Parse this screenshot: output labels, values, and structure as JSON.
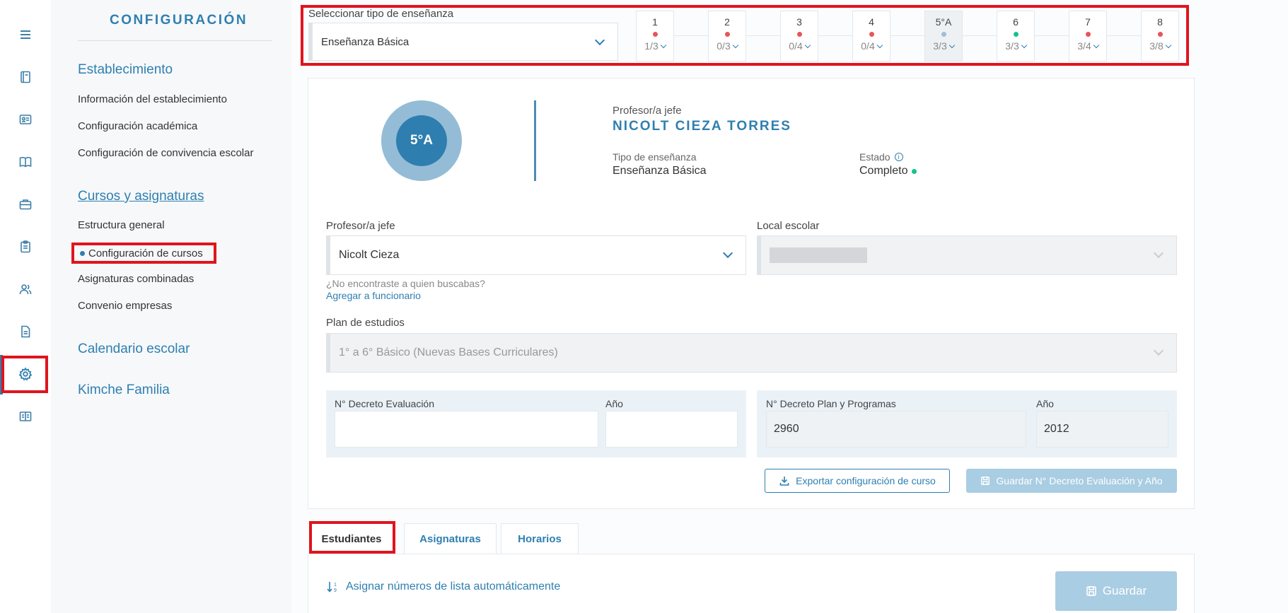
{
  "sidebar": {
    "title": "CONFIGURACIÓN",
    "sections": [
      {
        "label": "Establecimiento"
      },
      {
        "label": "Cursos y asignaturas"
      },
      {
        "label": "Calendario escolar"
      },
      {
        "label": "Kimche Familia"
      }
    ],
    "establecimiento_links": [
      "Información del establecimiento",
      "Configuración académica",
      "Configuración de convivencia escolar"
    ],
    "cursos_links": [
      "Estructura general",
      "Configuración de cursos",
      "Asignaturas combinadas",
      "Convenio empresas"
    ],
    "active_link": "Configuración de cursos"
  },
  "rail_icons": [
    "menu-icon",
    "notebook-icon",
    "id-card-icon",
    "book-open-icon",
    "briefcase-icon",
    "clipboard-icon",
    "users-icon",
    "document-icon",
    "gear-icon",
    "book-icon"
  ],
  "topbar": {
    "tipo_label": "Seleccionar tipo de enseñanza",
    "tipo_value": "Enseñanza Básica",
    "grades": [
      {
        "name": "1",
        "count": "1/3",
        "status_color": "#e8545a"
      },
      {
        "name": "2",
        "count": "0/3",
        "status_color": "#e8545a"
      },
      {
        "name": "3",
        "count": "0/4",
        "status_color": "#e8545a"
      },
      {
        "name": "4",
        "count": "0/4",
        "status_color": "#e8545a"
      },
      {
        "name": "5°A",
        "count": "3/3",
        "status_color": "#9cbfd8"
      },
      {
        "name": "6",
        "count": "3/3",
        "status_color": "#12c48b"
      },
      {
        "name": "7",
        "count": "3/4",
        "status_color": "#e8545a"
      },
      {
        "name": "8",
        "count": "3/8",
        "status_color": "#e8545a"
      }
    ]
  },
  "course": {
    "badge": "5°A",
    "profesor_label": "Profesor/a jefe",
    "profesor_name": "NICOLT CIEZA TORRES",
    "tipo_label": "Tipo de enseñanza",
    "tipo_value": "Enseñanza Básica",
    "estado_label": "Estado",
    "estado_value": "Completo"
  },
  "form": {
    "profesor_label": "Profesor/a jefe",
    "profesor_value": "Nicolt Cieza",
    "local_label": "Local escolar",
    "hint": "¿No encontraste a quien buscabas?",
    "add_link": "Agregar a funcionario",
    "plan_label": "Plan de estudios",
    "plan_value": "1° a 6° Básico (Nuevas Bases Curriculares)",
    "decreto_eval_label": "N° Decreto Evaluación",
    "decreto_eval_value": "",
    "anio_eval_label": "Año",
    "anio_eval_value": "",
    "decreto_plan_label": "N° Decreto Plan y Programas",
    "decreto_plan_value": "2960",
    "anio_plan_label": "Año",
    "anio_plan_value": "2012",
    "export_button": "Exportar configuración de curso",
    "save_decreto_button": "Guardar N° Decreto Evaluación y Año"
  },
  "tabs": [
    {
      "label": "Estudiantes",
      "active": true
    },
    {
      "label": "Asignaturas",
      "active": false
    },
    {
      "label": "Horarios",
      "active": false
    }
  ],
  "students_panel": {
    "auto_numbers": "Asignar números de lista automáticamente",
    "save_button": "Guardar"
  },
  "colors": {
    "accent": "#2f7fb0",
    "highlight": "#e0141e",
    "complete": "#12c48b",
    "incomplete": "#e8545a"
  }
}
